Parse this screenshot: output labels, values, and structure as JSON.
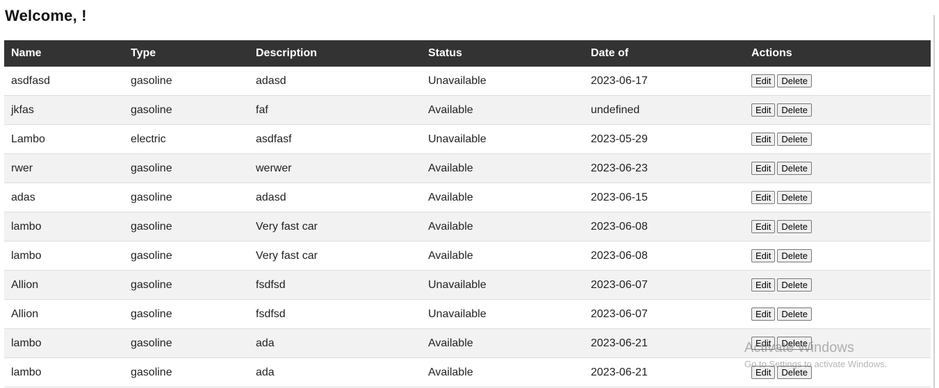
{
  "header": {
    "title": "Welcome, !"
  },
  "table": {
    "columns": [
      "Name",
      "Type",
      "Description",
      "Status",
      "Date of",
      "Actions"
    ],
    "rows": [
      {
        "name": "asdfasd",
        "type": "gasoline",
        "description": "adasd",
        "status": "Unavailable",
        "date": "2023-06-17"
      },
      {
        "name": "jkfas",
        "type": "gasoline",
        "description": "faf",
        "status": "Available",
        "date": "undefined"
      },
      {
        "name": "Lambo",
        "type": "electric",
        "description": "asdfasf",
        "status": "Unavailable",
        "date": "2023-05-29"
      },
      {
        "name": "rwer",
        "type": "gasoline",
        "description": "werwer",
        "status": "Available",
        "date": "2023-06-23"
      },
      {
        "name": "adas",
        "type": "gasoline",
        "description": "adasd",
        "status": "Available",
        "date": "2023-06-15"
      },
      {
        "name": "lambo",
        "type": "gasoline",
        "description": "Very fast car",
        "status": "Available",
        "date": "2023-06-08"
      },
      {
        "name": "lambo",
        "type": "gasoline",
        "description": "Very fast car",
        "status": "Available",
        "date": "2023-06-08"
      },
      {
        "name": "Allion",
        "type": "gasoline",
        "description": "fsdfsd",
        "status": "Unavailable",
        "date": "2023-06-07"
      },
      {
        "name": "Allion",
        "type": "gasoline",
        "description": "fsdfsd",
        "status": "Unavailable",
        "date": "2023-06-07"
      },
      {
        "name": "lambo",
        "type": "gasoline",
        "description": "ada",
        "status": "Available",
        "date": "2023-06-21"
      },
      {
        "name": "lambo",
        "type": "gasoline",
        "description": "ada",
        "status": "Available",
        "date": "2023-06-21"
      }
    ],
    "edit_label": "Edit",
    "delete_label": "Delete"
  },
  "watermark": {
    "title": "Activate Windows",
    "subtitle": "Go to Settings to activate Windows."
  },
  "colors": {
    "header_bg": "#333333",
    "header_text": "#ffffff",
    "row_alt": "#f2f2f2"
  }
}
